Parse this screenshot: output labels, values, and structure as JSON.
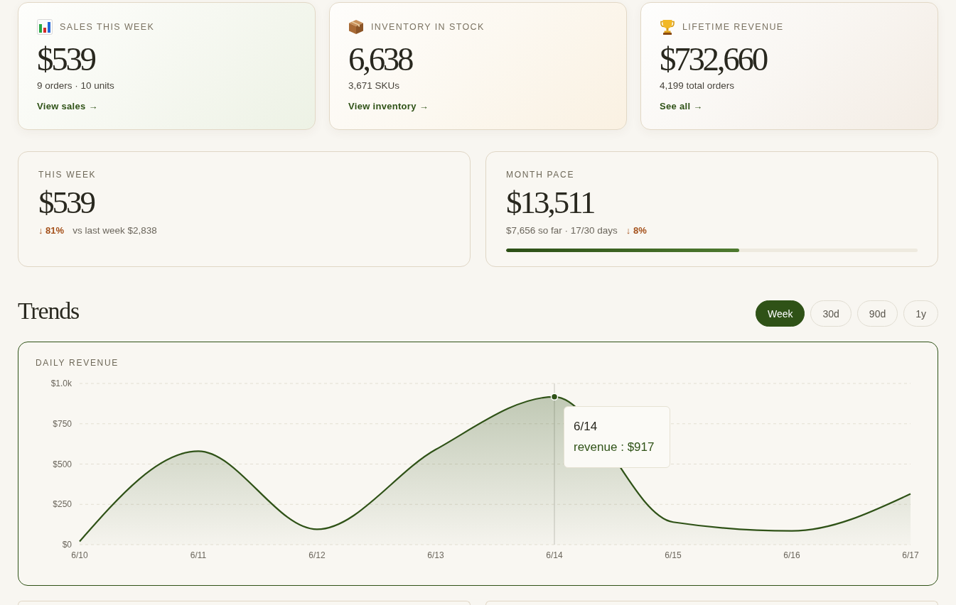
{
  "stat_cards": [
    {
      "label": "SALES THIS WEEK",
      "value": "$539",
      "detail": "9 orders · 10 units",
      "link": "View sales →"
    },
    {
      "label": "INVENTORY IN STOCK",
      "value": "6,638",
      "detail": "3,671 SKUs",
      "link": "View inventory →"
    },
    {
      "label": "LIFETIME REVENUE",
      "value": "$732,660",
      "detail": "4,199 total orders",
      "link": "See all →"
    }
  ],
  "summary_cards": [
    {
      "kind": "comparison",
      "label": "THIS WEEK",
      "value": "$539",
      "change": "↓ 81%",
      "detail": "vs last week $2,838"
    },
    {
      "kind": "pace",
      "label": "MONTH PACE",
      "value": "$13,511",
      "detail": "$7,656 so far · 17/30 days",
      "change": "↓ 8%",
      "level": 0.567
    }
  ],
  "trends": {
    "title": "Trends",
    "ranges": [
      {
        "label": "Week",
        "selected": true
      },
      {
        "label": "30d",
        "selected": false
      },
      {
        "label": "90d",
        "selected": false
      },
      {
        "label": "1y",
        "selected": false
      }
    ],
    "chart": {
      "chart_data": {
        "type": "area",
        "title": "DAILY REVENUE",
        "categories": [
          "6/10",
          "6/11",
          "6/12",
          "6/13",
          "6/14",
          "6/15",
          "6/16",
          "6/17"
        ],
        "series": [
          {
            "name": "revenue",
            "color": "#2f5217",
            "values": [
              20,
              580,
              95,
              590,
              917,
              140,
              85,
              315
            ]
          }
        ],
        "ylim": [
          0,
          1000
        ],
        "yticks": [
          {
            "value": 0,
            "label": "$0"
          },
          {
            "value": 250,
            "label": "$250"
          },
          {
            "value": 500,
            "label": "$500"
          },
          {
            "value": 750,
            "label": "$750"
          },
          {
            "value": 1000,
            "label": "$1.0k"
          }
        ],
        "grid": true,
        "ref_lines": [
          {
            "axis": "x",
            "value": "6/14"
          }
        ]
      },
      "tooltip": {
        "title": "6/14",
        "separator": ":",
        "value": "$917"
      }
    }
  }
}
